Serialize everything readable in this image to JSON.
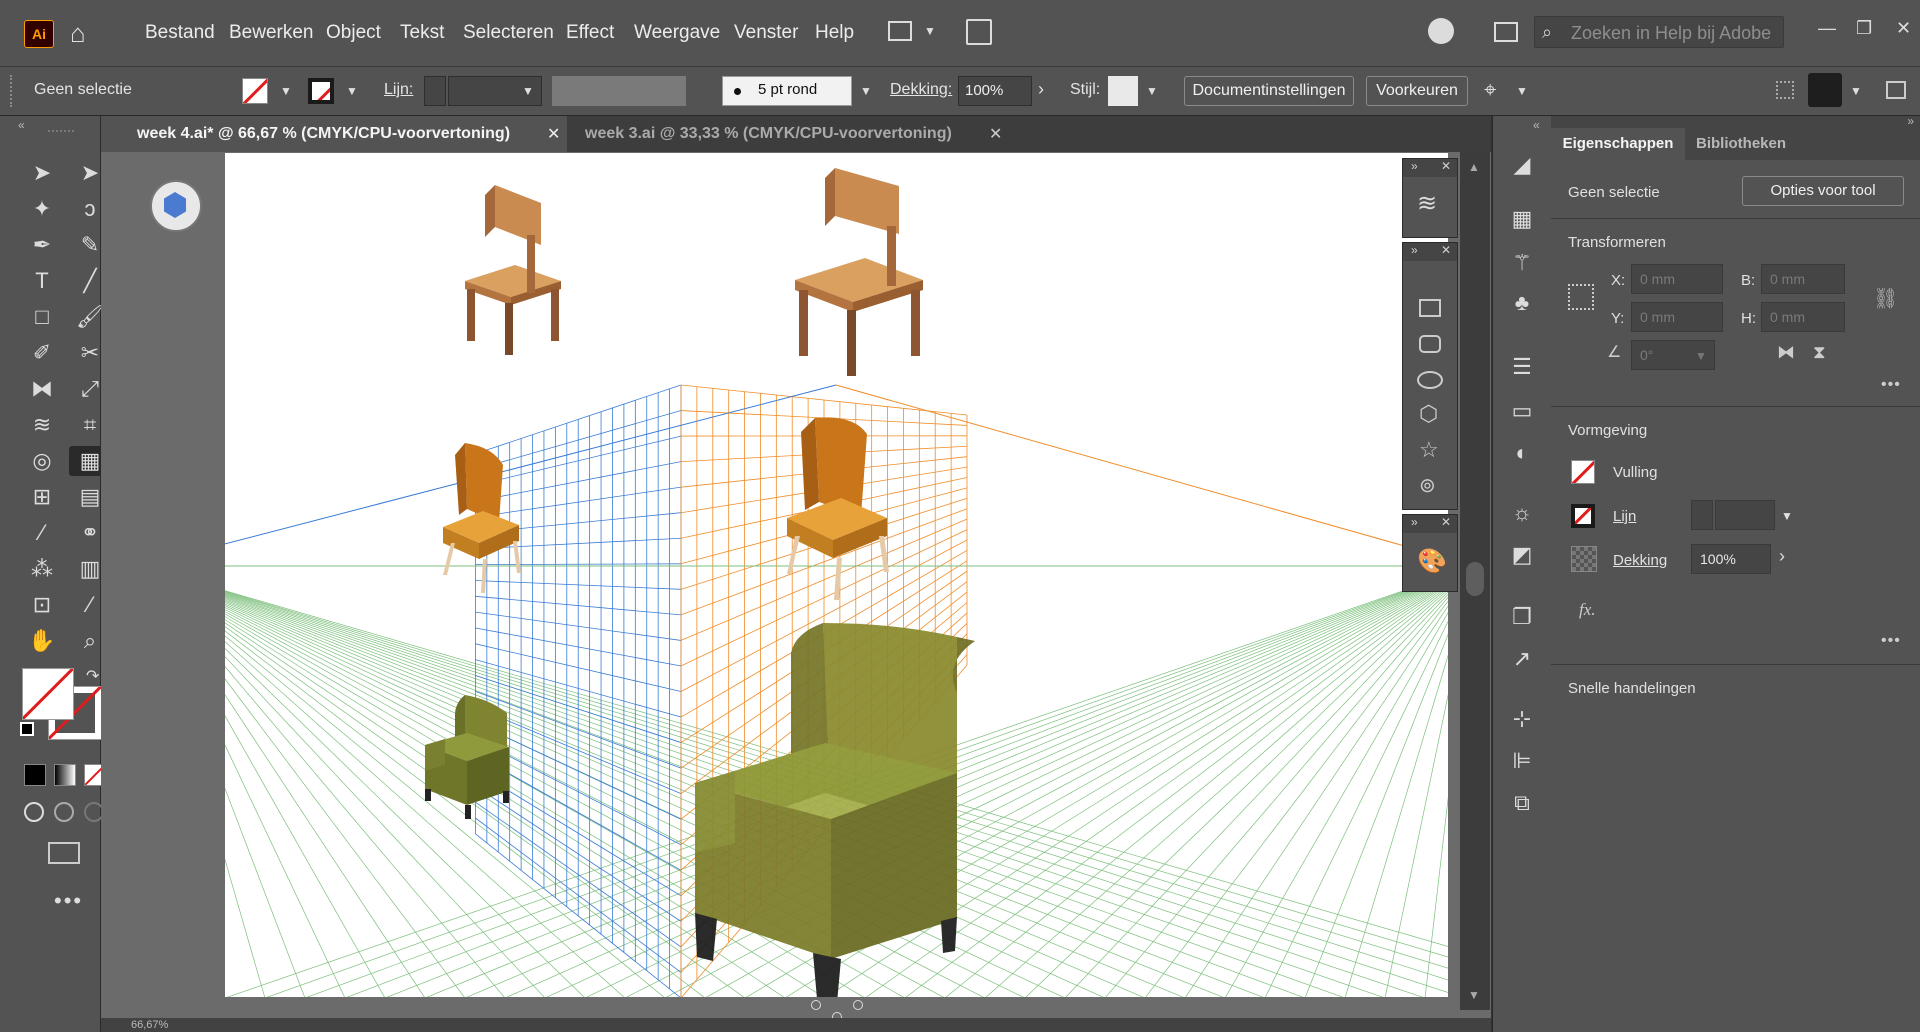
{
  "app": {
    "logo": "Ai",
    "home_icon": "home-icon"
  },
  "menu": [
    "Bestand",
    "Bewerken",
    "Object",
    "Tekst",
    "Selecteren",
    "Effect",
    "Weergave",
    "Venster",
    "Help"
  ],
  "search": {
    "placeholder": "Zoeken in Help bij Adobe"
  },
  "control_bar": {
    "selection_status": "Geen selectie",
    "stroke_label": "Lijn:",
    "brush_label": "5 pt rond",
    "opacity_label": "Dekking:",
    "opacity_value": "100%",
    "style_label": "Stijl:",
    "doc_settings_button": "Documentinstellingen",
    "preferences_button": "Voorkeuren"
  },
  "tabs": [
    {
      "label": "week 4.ai* @ 66,67 % (CMYK/CPU-voorvertoning)",
      "active": true
    },
    {
      "label": "week 3.ai @ 33,33 % (CMYK/CPU-voorvertoning)",
      "active": false
    }
  ],
  "status_bar": {
    "zoom": "66,67%"
  },
  "properties_panel": {
    "tabs": [
      "Eigenschappen",
      "Bibliotheken"
    ],
    "selection_status": "Geen selectie",
    "tool_options_button": "Opties voor tool",
    "transform": {
      "title": "Transformeren",
      "x_label": "X:",
      "x_value": "0 mm",
      "y_label": "Y:",
      "y_value": "0 mm",
      "w_label": "B:",
      "w_value": "0 mm",
      "h_label": "H:",
      "h_value": "0 mm",
      "angle_value": "0°"
    },
    "appearance": {
      "title": "Vormgeving",
      "fill_label": "Vulling",
      "stroke_label": "Lijn",
      "opacity_label": "Dekking",
      "opacity_value": "100%",
      "fx_label": "fx."
    },
    "quick_actions_title": "Snelle handelingen"
  },
  "colors": {
    "chrome": "#535353",
    "canvas": "#6b6b6b",
    "grid_left": "#3a7bd5",
    "grid_right": "#f08c28",
    "grid_ground": "#7cbf7c",
    "accent_red": "#e01c1c"
  }
}
